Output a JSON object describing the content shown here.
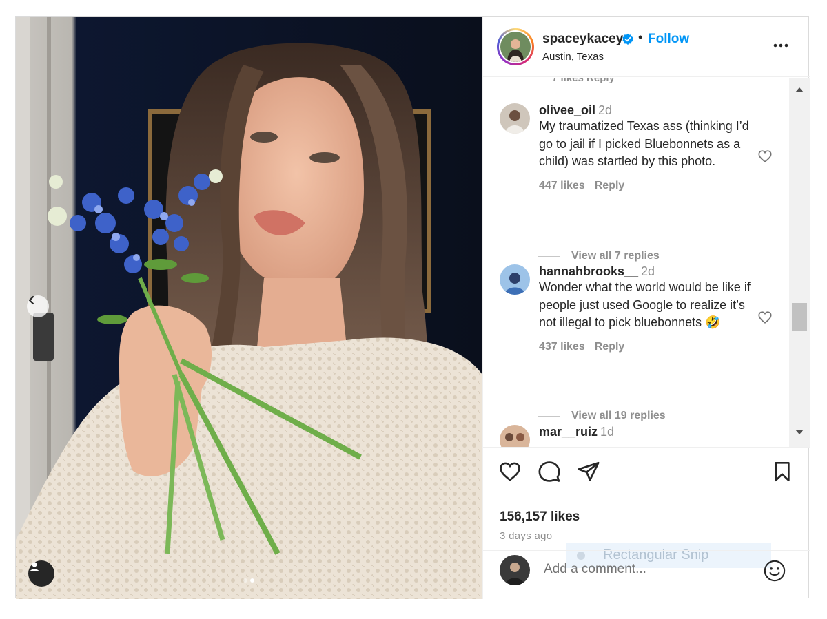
{
  "post": {
    "username": "spaceykacey",
    "follow_label": "Follow",
    "separator": "•",
    "location": "Austin, Texas"
  },
  "comments": [
    {
      "user": "olivee_oil",
      "time": "2d",
      "text": "My traumatized Texas ass (thinking I’d go to jail if I picked Bluebonnets as a child) was startled by this photo.",
      "likes": "447 likes",
      "reply_label": "Reply",
      "view_replies": "View all 7 replies"
    },
    {
      "user": "hannahbrooks__",
      "time": "2d",
      "text": "Wonder what the world would be like if people just used Google to realize it’s not illegal to pick bluebonnets 🤣",
      "likes": "437 likes",
      "reply_label": "Reply",
      "view_replies": "View all 19 replies"
    },
    {
      "user": "mar__ruiz",
      "time": "1d"
    }
  ],
  "cut_off_text": "7 likes   Reply",
  "stats": {
    "likes": "156,157 likes",
    "posted": "3 days ago"
  },
  "overlay": {
    "snip_label": "Rectangular Snip"
  },
  "composer": {
    "placeholder": "Add a comment..."
  },
  "icons": {
    "verified": "verified-badge-icon",
    "more": "more-options-icon",
    "like": "heart-icon",
    "comment": "comment-bubble-icon",
    "share": "paper-plane-icon",
    "save": "bookmark-icon",
    "emoji": "smiley-icon",
    "prev": "chevron-left-icon",
    "tag": "user-tag-icon"
  },
  "colors": {
    "accent": "#0095f6",
    "text": "#262626",
    "muted": "#8e8e8e"
  }
}
